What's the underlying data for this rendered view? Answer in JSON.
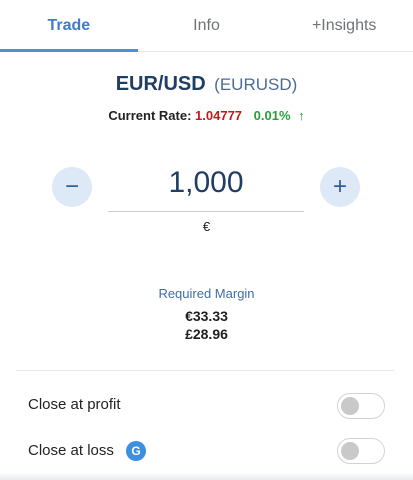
{
  "tabs": [
    {
      "label": "Trade",
      "active": true
    },
    {
      "label": "Info",
      "active": false
    },
    {
      "label": "+Insights",
      "active": false
    }
  ],
  "instrument": {
    "pair": "EUR/USD",
    "code": "(EURUSD)"
  },
  "rate": {
    "label": "Current Rate:",
    "value": "1.04777",
    "change": "0.01%",
    "arrow": "↑"
  },
  "amount": {
    "minus": "−",
    "value": "1,000",
    "plus": "+",
    "currency": "€"
  },
  "margin": {
    "label": "Required Margin",
    "values": [
      "€33.33",
      "£28.96"
    ]
  },
  "options": [
    {
      "label": "Close at profit",
      "enabled": false
    },
    {
      "label": "Close at loss",
      "enabled": false,
      "badge": "G"
    }
  ],
  "colors": {
    "accent": "#4f8fd6",
    "rate": "#c21a1a",
    "change": "#2a9e39",
    "title": "#203d63"
  }
}
